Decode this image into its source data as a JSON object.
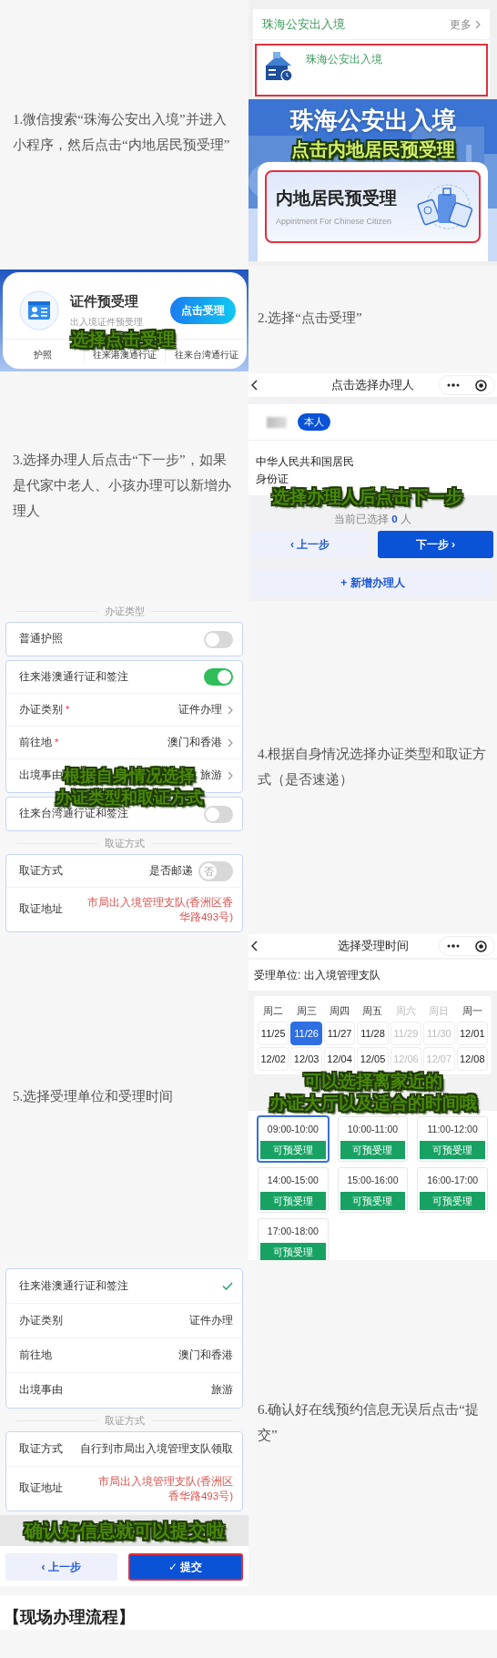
{
  "steps": [
    {
      "text": "1.微信搜索“珠海公安出入境”并进入小程序，然后点击“内地居民预受理”",
      "screen": {
        "kind": "search",
        "section_title": "珠海公安出入境",
        "more": "更多",
        "result_name": "珠海公安出入境",
        "banner_title": "珠海公安出入境",
        "caption": "点击内地居民预受理",
        "card_title": "内地居民预受理",
        "card_subtitle": "Appintment For Chinese Citizen"
      }
    },
    {
      "text": "2.选择“点击受理”",
      "screen": {
        "kind": "service",
        "title": "证件预受理",
        "subtitle": "出入境证件预受理",
        "button": "点击受理",
        "caption": "选择点击受理",
        "tabs": [
          "护照",
          "往来港澳通行证",
          "往来台湾通行证"
        ]
      }
    },
    {
      "text": "3.选择办理人后点击“下一步”，如果是代家中老人、小孩办理可以新增办理人",
      "screen": {
        "kind": "applicant",
        "title": "点击选择办理人",
        "tag": "本人",
        "id_type": "中华人民共和国居民身份证",
        "caption": "选择办理人后点击下一步",
        "count": "当前已选择 **0** 人",
        "prev": "‹ 上一步",
        "next": "下一步 ›",
        "add": "+ 新增办理人"
      }
    },
    {
      "text": "4.根据自身情况选择办证类型和取证方式（是否速递）",
      "screen": {
        "kind": "form",
        "section_1": "办证类型",
        "groups": [
          {
            "rows": [
              {
                "kind": "toggle",
                "label": "普通护照",
                "on": false
              }
            ]
          },
          {
            "rows": [
              {
                "kind": "toggle",
                "label": "往来港澳通行证和签注",
                "on": true
              },
              {
                "kind": "select",
                "label": "办证类别",
                "required_mark": "*",
                "value": "证件办理"
              },
              {
                "kind": "select",
                "label": "前往地",
                "required_mark": "*",
                "value": "澳门和香港"
              },
              {
                "kind": "select",
                "label": "出境事由",
                "value": "旅游"
              }
            ]
          },
          {
            "rows": [
              {
                "kind": "toggle",
                "label": "往来台湾通行证和签注",
                "on": false
              }
            ]
          }
        ],
        "section_2": "取证方式",
        "pickup_rows": [
          {
            "kind": "toggle",
            "label": "取证方式",
            "value": "是否邮递",
            "on": false,
            "knob_text": "否"
          },
          {
            "kind": "address",
            "label": "取证地址",
            "value": "市局出入境管理支队(香洲区香华路493号)"
          }
        ],
        "caption_lines": [
          "根据自身情况选择",
          "办证类型和取证方式"
        ]
      }
    },
    {
      "text": "5.选择受理单位和受理时间",
      "screen": {
        "kind": "schedule",
        "title": "选择受理时间",
        "unit": "受理单位: 出入境管理支队",
        "weekdays": [
          {
            "label": "周二",
            "disabled": false
          },
          {
            "label": "周三",
            "disabled": false
          },
          {
            "label": "周四",
            "disabled": false
          },
          {
            "label": "周五",
            "disabled": false
          },
          {
            "label": "周六",
            "disabled": true
          },
          {
            "label": "周日",
            "disabled": true
          },
          {
            "label": "周一",
            "disabled": false
          }
        ],
        "dates": [
          {
            "label": "11/25",
            "selected": false,
            "disabled": false
          },
          {
            "label": "11/26",
            "selected": true,
            "disabled": false
          },
          {
            "label": "11/27",
            "selected": false,
            "disabled": false
          },
          {
            "label": "11/28",
            "selected": false,
            "disabled": false
          },
          {
            "label": "11/29",
            "selected": false,
            "disabled": true
          },
          {
            "label": "11/30",
            "selected": false,
            "disabled": true
          },
          {
            "label": "12/01",
            "selected": false,
            "disabled": false
          },
          {
            "label": "12/02",
            "selected": false,
            "disabled": false
          },
          {
            "label": "12/03",
            "selected": false,
            "disabled": false
          },
          {
            "label": "12/04",
            "selected": false,
            "disabled": false
          },
          {
            "label": "12/05",
            "selected": false,
            "disabled": false
          },
          {
            "label": "12/06",
            "selected": false,
            "disabled": true
          },
          {
            "label": "12/07",
            "selected": false,
            "disabled": true
          },
          {
            "label": "12/08",
            "selected": false,
            "disabled": false
          }
        ],
        "caption_lines": [
          "可以选择离家近的",
          "办证大厅以及适合的时间哦"
        ],
        "slots": [
          {
            "time": "09:00-10:00",
            "status": "可预受理",
            "selected": true
          },
          {
            "time": "10:00-11:00",
            "status": "可预受理",
            "selected": false
          },
          {
            "time": "11:00-12:00",
            "status": "可预受理",
            "selected": false
          },
          {
            "time": "14:00-15:00",
            "status": "可预受理",
            "selected": false
          },
          {
            "time": "15:00-16:00",
            "status": "可预受理",
            "selected": false
          },
          {
            "time": "16:00-17:00",
            "status": "可预受理",
            "selected": false
          },
          {
            "time": "17:00-18:00",
            "status": "可预受理",
            "selected": false
          }
        ]
      }
    },
    {
      "text": "6.确认好在线预约信息无误后点击“提交”",
      "screen": {
        "kind": "confirm",
        "rows": [
          {
            "label": "往来港澳通行证和签注",
            "checked": true
          },
          {
            "label": "办证类别",
            "value": "证件办理"
          },
          {
            "label": "前往地",
            "value": "澳门和香港"
          },
          {
            "label": "出境事由",
            "value": "旅游"
          }
        ],
        "section": "取证方式",
        "pickup_rows": [
          {
            "kind": "plain",
            "label": "取证方式",
            "value": "自行到市局出入境管理支队领取"
          },
          {
            "kind": "address",
            "label": "取证地址",
            "value": "市局出入境管理支队(香洲区香华路493号)"
          }
        ],
        "caption": "确认好信息就可以提交啦",
        "prev": "‹ 上一步",
        "submit": "✓ 提交"
      }
    }
  ],
  "footer_heading": "【现场办理流程】"
}
